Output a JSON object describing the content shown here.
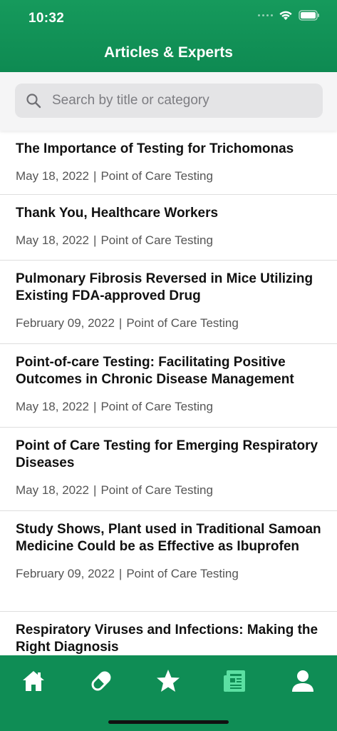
{
  "status_bar": {
    "time": "10:32"
  },
  "header": {
    "title": "Articles & Experts"
  },
  "search": {
    "placeholder": "Search by title or category",
    "value": ""
  },
  "articles": [
    {
      "title": "The Importance of Testing for Trichomonas",
      "date": "May 18, 2022",
      "separator": "|",
      "category": "Point of Care Testing"
    },
    {
      "title": "Thank You, Healthcare Workers",
      "date": "May 18, 2022",
      "separator": "|",
      "category": "Point of Care Testing"
    },
    {
      "title": "Pulmonary Fibrosis Reversed in Mice Utilizing Existing FDA-approved Drug",
      "date": "February 09, 2022",
      "separator": "|",
      "category": "Point of Care Testing"
    },
    {
      "title": "Point-of-care Testing: Facilitating Positive Outcomes in Chronic Disease Management",
      "date": "May 18, 2022",
      "separator": "|",
      "category": "Point of Care Testing"
    },
    {
      "title": "Point of Care Testing for Emerging Respiratory Diseases",
      "date": "May 18, 2022",
      "separator": "|",
      "category": "Point of Care Testing"
    },
    {
      "title": "Study Shows, Plant used in Traditional Samoan Medicine Could be as Effective as Ibuprofen",
      "date": "February 09, 2022",
      "separator": "|",
      "category": "Point of Care Testing"
    },
    {
      "title": "Respiratory Viruses and Infections: Making the Right Diagnosis",
      "date": "",
      "separator": "",
      "category": ""
    }
  ],
  "tab_bar": {
    "tabs": [
      {
        "icon": "home-icon",
        "active": false
      },
      {
        "icon": "pill-icon",
        "active": false
      },
      {
        "icon": "star-icon",
        "active": false
      },
      {
        "icon": "newspaper-icon",
        "active": true
      },
      {
        "icon": "person-icon",
        "active": false
      }
    ]
  },
  "colors": {
    "brand_green": "#0f8d55",
    "active_tab": "#5ce0a3",
    "inactive_tab": "#ffffff"
  }
}
